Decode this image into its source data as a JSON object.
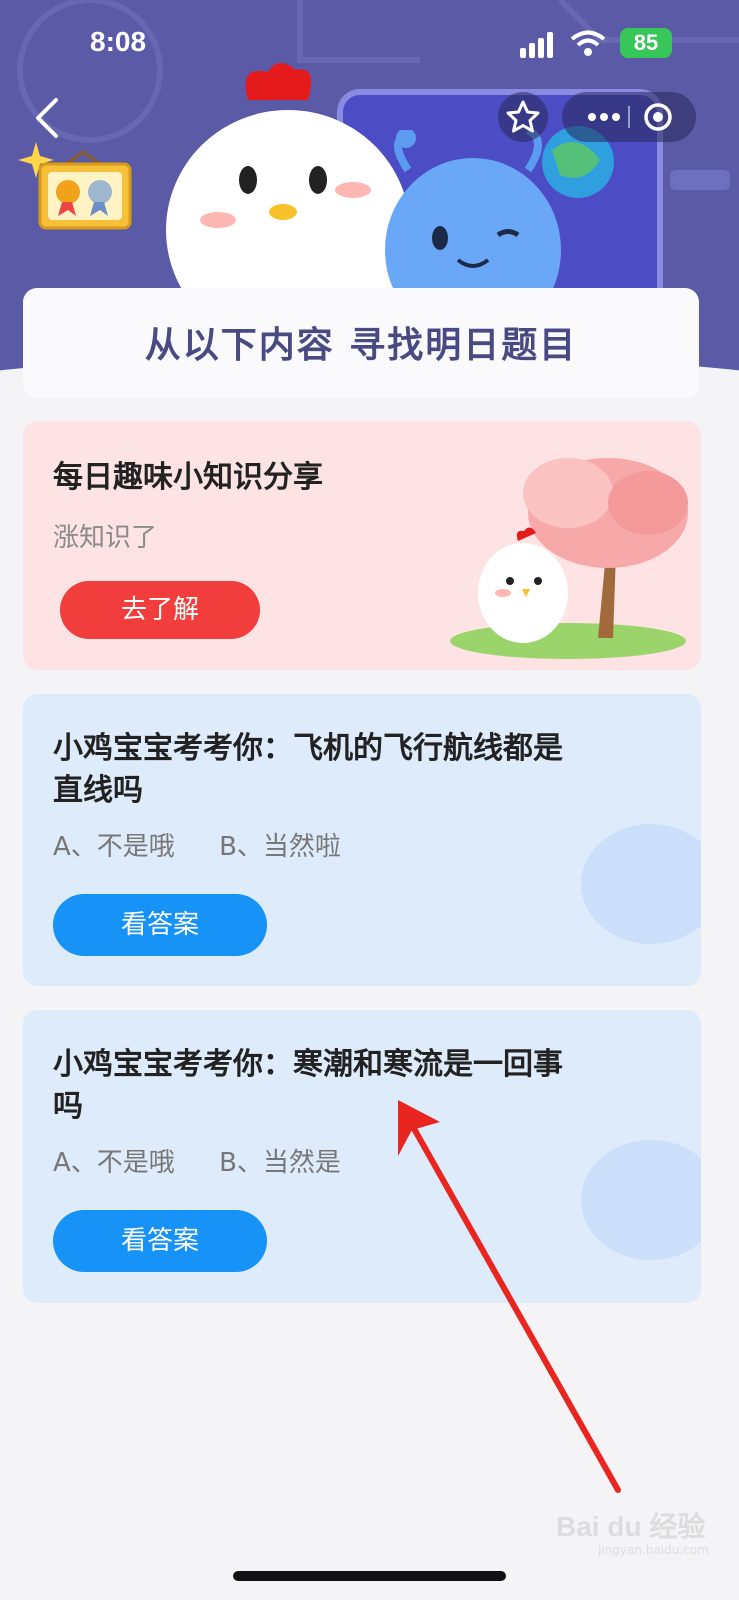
{
  "status_bar": {
    "time": "8:08",
    "battery": "85"
  },
  "banner": {
    "title": "从以下内容  寻找明日题目"
  },
  "knowledge_card": {
    "title": "每日趣味小知识分享",
    "subtitle": "涨知识了",
    "button_label": "去了解"
  },
  "quiz_cards": [
    {
      "title_line1": "小鸡宝宝考考你：飞机的飞行航线都是",
      "title_line2": "直线吗",
      "option_a": "A、不是哦",
      "option_b": "B、当然啦",
      "button_label": "看答案"
    },
    {
      "title_line1": "小鸡宝宝考考你：寒潮和寒流是一回事",
      "title_line2": "吗",
      "option_a": "A、不是哦",
      "option_b": "B、当然是",
      "button_label": "看答案"
    }
  ],
  "watermark": {
    "brand": "Bai du 经验",
    "domain": "jingyan.baidu.com"
  },
  "colors": {
    "hero_bg": "#5a5aa6",
    "knowledge_bg": "#fde3e4",
    "quiz_bg": "#deebfb",
    "red_button": "#f23d3d",
    "blue_button": "#1793f7",
    "annotation_arrow": "#e8251f"
  }
}
